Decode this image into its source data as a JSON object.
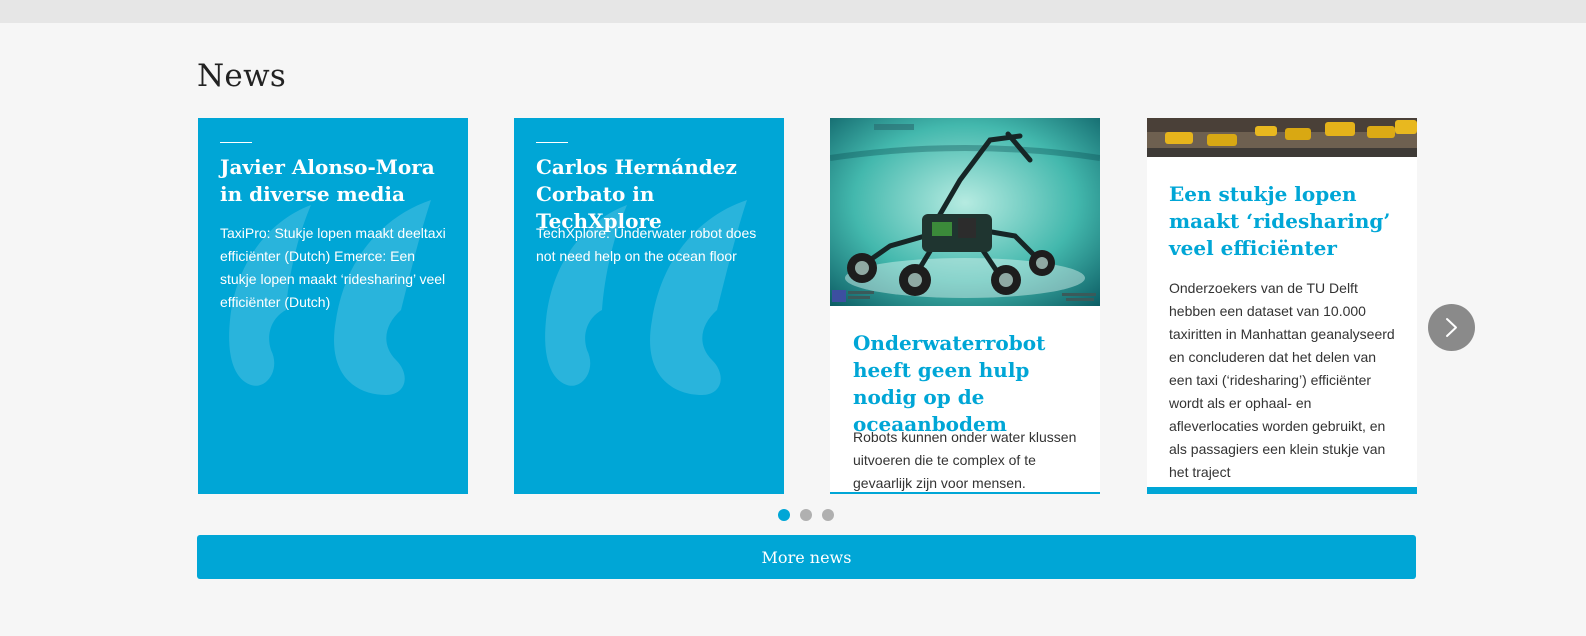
{
  "section": {
    "title": "News"
  },
  "cards": [
    {
      "title": "Javier Alonso-Mora in diverse media",
      "text": "TaxiPro: Stukje lopen maakt deeltaxi efficiënter (Dutch) Emerce: Een stukje lopen maakt ‘ridesharing’ veel efficiënter (Dutch)"
    },
    {
      "title": "Carlos Hernández Corbato in TechXplore",
      "text": "TechXplore: Underwater robot does not need help on the ocean floor"
    },
    {
      "title": "Onderwaterrobot heeft geen hulp nodig op de oceaanbodem",
      "text": "Robots kunnen onder water klussen uitvoeren die te complex of te gevaarlijk zijn voor mensen."
    },
    {
      "title": "Een stukje lopen maakt ‘ridesharing’ veel efficiënter",
      "text": "Onderzoekers van de TU Delft hebben een dataset van 10.000 taxiritten in Manhattan geanalyseerd en concluderen dat het delen van een taxi (‘ridesharing’) efficiënter wordt als er ophaal- en afleverlocaties worden gebruikt, en als passagiers een klein stukje van het traject"
    }
  ],
  "carousel": {
    "active_dot": 0,
    "dot_count": 3
  },
  "more_news": {
    "label": "More news"
  },
  "colors": {
    "accent": "#00a6d6",
    "background": "#f6f6f6",
    "topbar": "#e6e6e6",
    "arrow": "#8a8a8a",
    "dot_inactive": "#b0b0b0"
  },
  "icons": {
    "quote": "quote-mark-icon",
    "next": "chevron-right-icon"
  }
}
